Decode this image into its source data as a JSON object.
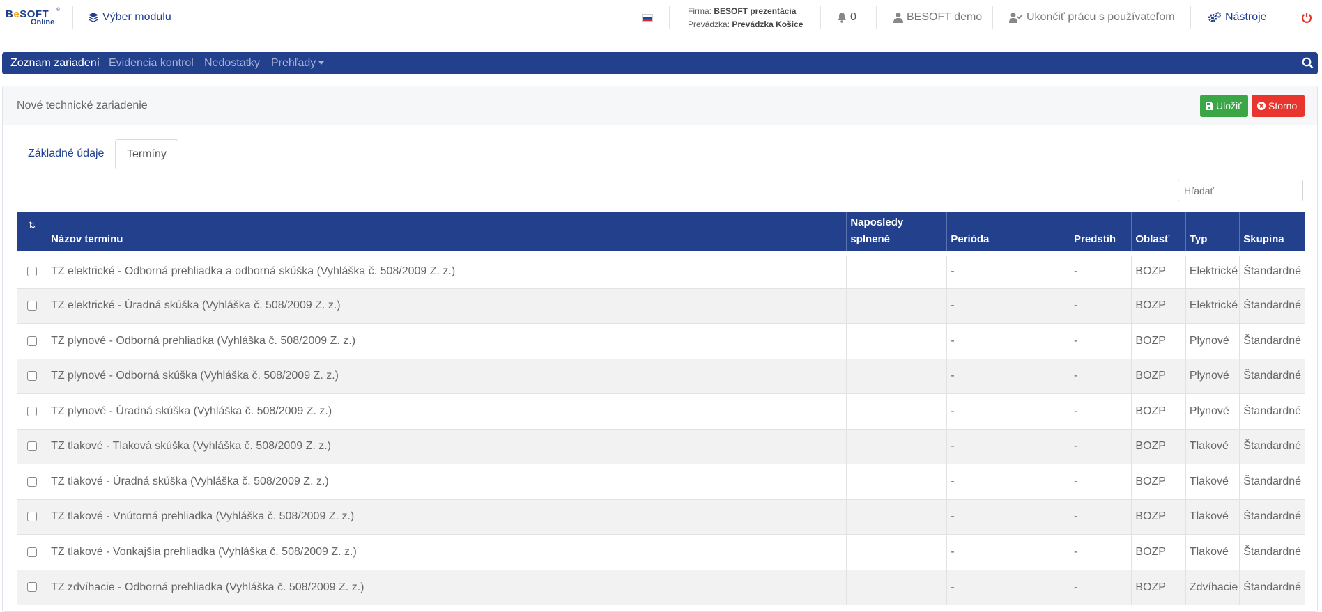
{
  "header": {
    "logo_text_a": "B",
    "logo_text_e": "e",
    "logo_text_b": "SOFT",
    "logo_sub": "Online",
    "logo_reg": "®",
    "module_label": "Výber modulu",
    "firm_label": "Firma:",
    "firm_value": "BESOFT prezentácia",
    "branch_label": "Prevádzka:",
    "branch_value": "Prevádzka Košice",
    "notifications_count": "0",
    "user_label": "BESOFT demo",
    "end_work_label": "Ukončiť prácu s používateľom",
    "tools_label": "Nástroje",
    "flag_colors": [
      "#ffffff",
      "#0b4ea2",
      "#ee1c25"
    ]
  },
  "nav": {
    "items": [
      {
        "label": "Zoznam zariadení",
        "active": true
      },
      {
        "label": "Evidencia kontrol",
        "active": false
      },
      {
        "label": "Nedostatky",
        "active": false
      },
      {
        "label": "Prehľady",
        "active": false
      }
    ]
  },
  "card": {
    "title": "Nové technické zariadenie",
    "save_label": "Uložiť",
    "cancel_label": "Storno"
  },
  "tabs": [
    {
      "label": "Základné údaje"
    },
    {
      "label": "Termíny"
    }
  ],
  "search": {
    "placeholder": "Hľadať"
  },
  "table": {
    "sort_icon": "⇅",
    "columns": [
      "Názov termínu",
      "Naposledy splnené",
      "Perióda",
      "Predstih",
      "Oblasť",
      "Typ",
      "Skupina"
    ],
    "rows": [
      {
        "name": "TZ elektrické - Odborná prehliadka a odborná skúška (Vyhláška č. 508/2009 Z. z.)",
        "last": "",
        "period": "-",
        "advance": "-",
        "area": "BOZP",
        "type": "Elektrické",
        "group": "Štandardné"
      },
      {
        "name": "TZ elektrické - Úradná skúška (Vyhláška č. 508/2009 Z. z.)",
        "last": "",
        "period": "-",
        "advance": "-",
        "area": "BOZP",
        "type": "Elektrické",
        "group": "Štandardné"
      },
      {
        "name": "TZ plynové - Odborná prehliadka (Vyhláška č. 508/2009 Z. z.)",
        "last": "",
        "period": "-",
        "advance": "-",
        "area": "BOZP",
        "type": "Plynové",
        "group": "Štandardné"
      },
      {
        "name": "TZ plynové - Odborná skúška (Vyhláška č. 508/2009 Z. z.)",
        "last": "",
        "period": "-",
        "advance": "-",
        "area": "BOZP",
        "type": "Plynové",
        "group": "Štandardné"
      },
      {
        "name": "TZ plynové - Úradná skúška (Vyhláška č. 508/2009 Z. z.)",
        "last": "",
        "period": "-",
        "advance": "-",
        "area": "BOZP",
        "type": "Plynové",
        "group": "Štandardné"
      },
      {
        "name": "TZ tlakové - Tlaková skúška (Vyhláška č. 508/2009 Z. z.)",
        "last": "",
        "period": "-",
        "advance": "-",
        "area": "BOZP",
        "type": "Tlakové",
        "group": "Štandardné"
      },
      {
        "name": "TZ tlakové - Úradná skúška (Vyhláška č. 508/2009 Z. z.)",
        "last": "",
        "period": "-",
        "advance": "-",
        "area": "BOZP",
        "type": "Tlakové",
        "group": "Štandardné"
      },
      {
        "name": "TZ tlakové - Vnútorná prehliadka (Vyhláška č. 508/2009 Z. z.)",
        "last": "",
        "period": "-",
        "advance": "-",
        "area": "BOZP",
        "type": "Tlakové",
        "group": "Štandardné"
      },
      {
        "name": "TZ tlakové - Vonkajšia prehliadka (Vyhláška č. 508/2009 Z. z.)",
        "last": "",
        "period": "-",
        "advance": "-",
        "area": "BOZP",
        "type": "Tlakové",
        "group": "Štandardné"
      },
      {
        "name": "TZ zdvíhacie - Odborná prehliadka (Vyhláška č. 508/2009 Z. z.)",
        "last": "",
        "period": "-",
        "advance": "-",
        "area": "BOZP",
        "type": "Zdvíhacie",
        "group": "Štandardné"
      }
    ]
  },
  "colors": {
    "nav_bg": "#22408c",
    "brand": "#1f3f8f",
    "save": "#3aa646",
    "cancel": "#e8362f",
    "power": "#e8362f"
  }
}
